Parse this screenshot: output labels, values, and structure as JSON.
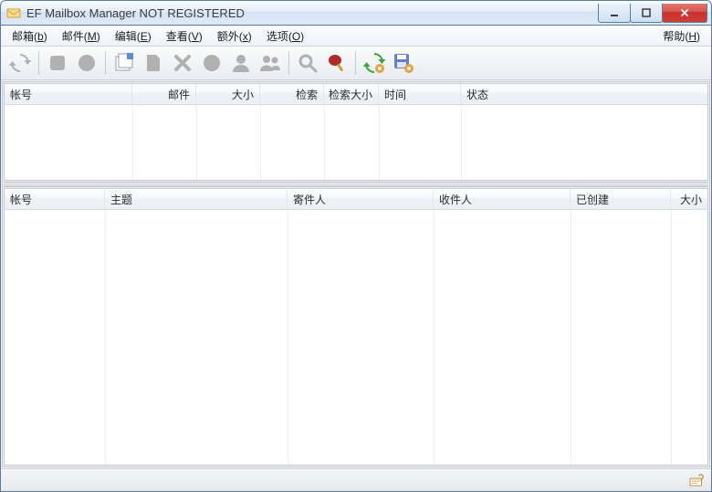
{
  "window": {
    "title": "EF Mailbox Manager NOT REGISTERED"
  },
  "menu": {
    "mailbox": {
      "label": "邮箱",
      "accel": "b"
    },
    "mail": {
      "label": "邮件",
      "accel": "M"
    },
    "edit": {
      "label": "编辑",
      "accel": "E"
    },
    "view": {
      "label": "查看",
      "accel": "V"
    },
    "extras": {
      "label": "额外",
      "accel": "x"
    },
    "options": {
      "label": "选项",
      "accel": "O"
    },
    "help": {
      "label": "帮助",
      "accel": "H"
    }
  },
  "toolbar_icons": {
    "refresh_all": "refresh-icon",
    "stop": "stop-icon",
    "record": "circle-icon",
    "new_mail": "new-mail-icon",
    "blank": "page-icon",
    "delete": "delete-icon",
    "mark_read": "dot-icon",
    "contacts": "person-icon",
    "block": "people-icon",
    "search": "search-icon",
    "flag": "paddle-icon",
    "sync": "refresh-gear-icon",
    "save": "save-gear-icon"
  },
  "upper_table": {
    "columns": {
      "account": "帐号",
      "mail": "邮件",
      "size": "大小",
      "index": "检索",
      "index_size": "检索大小",
      "time": "时间",
      "status": "状态"
    },
    "widths": [
      140,
      70,
      70,
      70,
      60,
      90,
      270
    ]
  },
  "lower_table": {
    "columns": {
      "account": "帐号",
      "subject": "主题",
      "sender": "寄件人",
      "recipient": "收件人",
      "created": "已创建",
      "size": "大小"
    },
    "widths": [
      110,
      200,
      160,
      150,
      110,
      40
    ]
  },
  "statusbar": {
    "icon": "hand-paper-icon"
  }
}
